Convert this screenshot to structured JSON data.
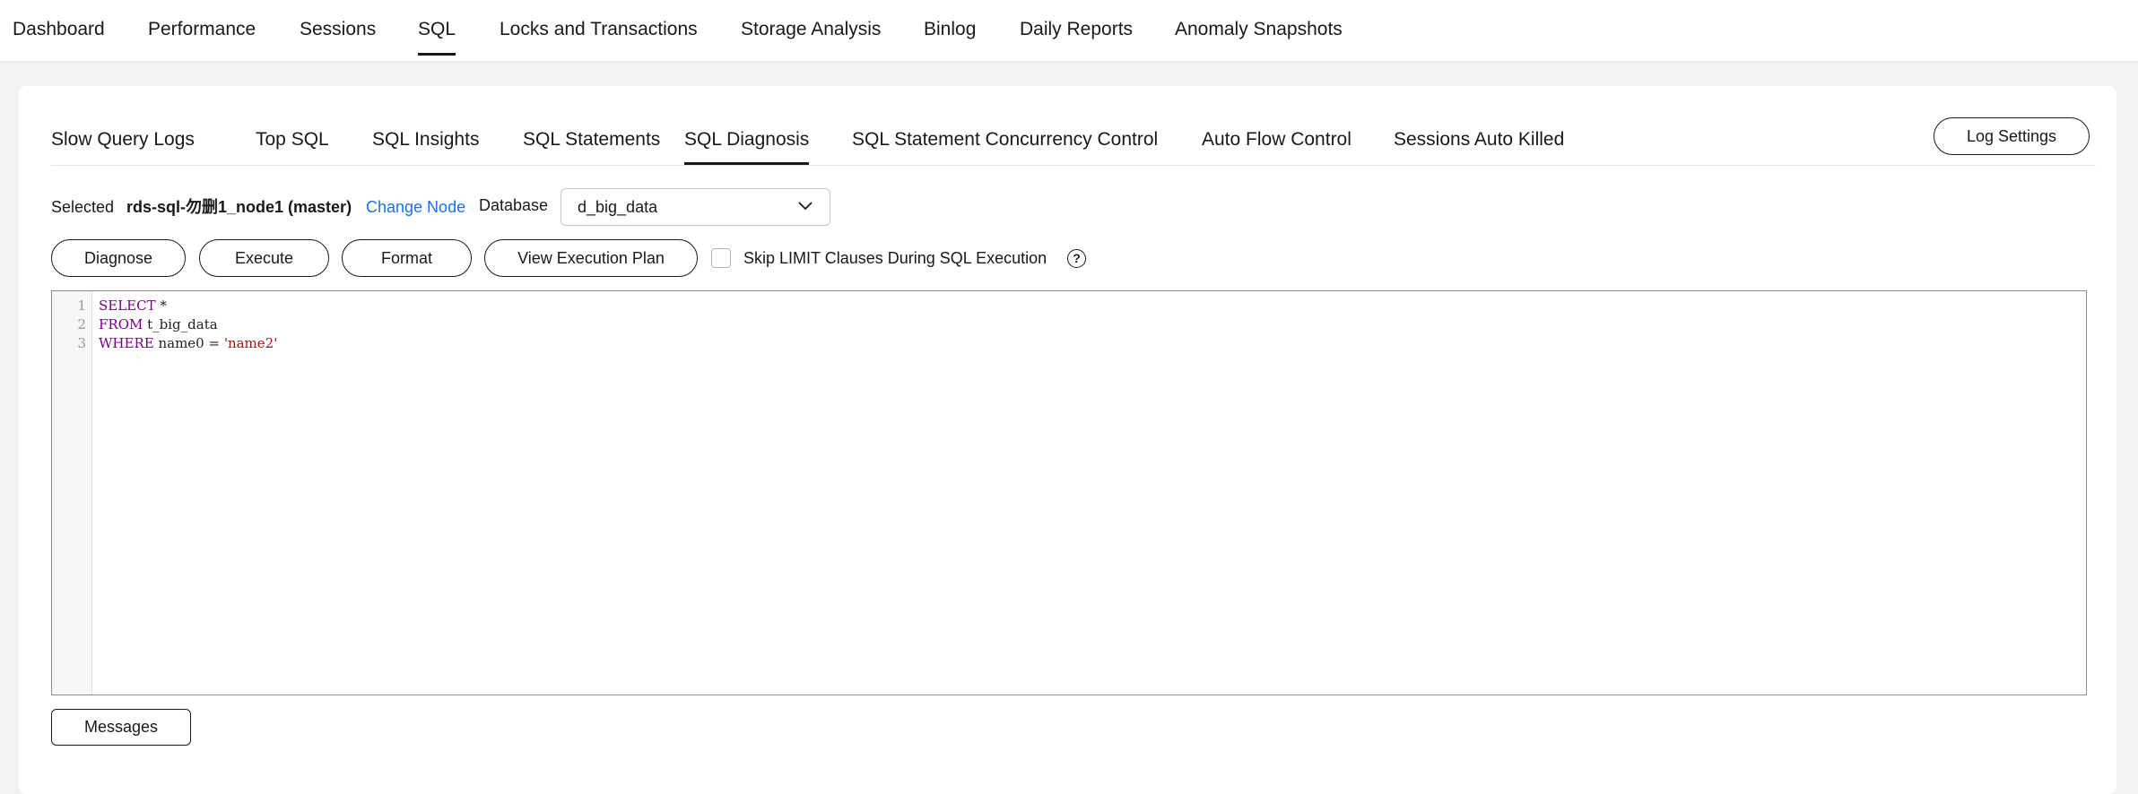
{
  "top_nav": {
    "items": [
      {
        "label": "Dashboard"
      },
      {
        "label": "Performance"
      },
      {
        "label": "Sessions"
      },
      {
        "label": "SQL",
        "active": true
      },
      {
        "label": "Locks and Transactions"
      },
      {
        "label": "Storage Analysis"
      },
      {
        "label": "Binlog"
      },
      {
        "label": "Daily Reports"
      },
      {
        "label": "Anomaly Snapshots"
      }
    ]
  },
  "sub_tabs": {
    "items": [
      {
        "label": "Slow Query Logs"
      },
      {
        "label": "Top SQL"
      },
      {
        "label": "SQL Insights"
      },
      {
        "label": "SQL Statements"
      },
      {
        "label": "SQL Diagnosis",
        "active": true
      },
      {
        "label": "SQL Statement Concurrency Control"
      },
      {
        "label": "Auto Flow Control"
      },
      {
        "label": "Sessions Auto Killed"
      }
    ],
    "log_settings_label": "Log Settings"
  },
  "node": {
    "selected_label": "Selected",
    "node_name": "rds-sql-勿删1_node1 (master)",
    "change_node_label": "Change Node",
    "database_label": "Database",
    "database_value": "d_big_data"
  },
  "actions": {
    "diagnose_label": "Diagnose",
    "execute_label": "Execute",
    "format_label": "Format",
    "view_plan_label": "View Execution Plan",
    "skip_limit_label": "Skip LIMIT Clauses During SQL Execution",
    "skip_limit_checked": false,
    "help_glyph": "?"
  },
  "editor": {
    "line_numbers": [
      "1",
      "2",
      "3"
    ],
    "lines": [
      {
        "keyword": "SELECT",
        "rest": " *",
        "string": ""
      },
      {
        "keyword": "FROM",
        "rest": " t_big_data",
        "string": ""
      },
      {
        "keyword": "WHERE",
        "rest": " name0 = ",
        "string": "'name2'"
      }
    ]
  },
  "messages": {
    "label": "Messages"
  },
  "colors": {
    "link": "#1a73e8",
    "keyword": "#770088",
    "string": "#aa1111",
    "text": "#191919"
  },
  "icons": {
    "select_arrow": "chevron-down-icon",
    "help": "question-circle-icon"
  }
}
